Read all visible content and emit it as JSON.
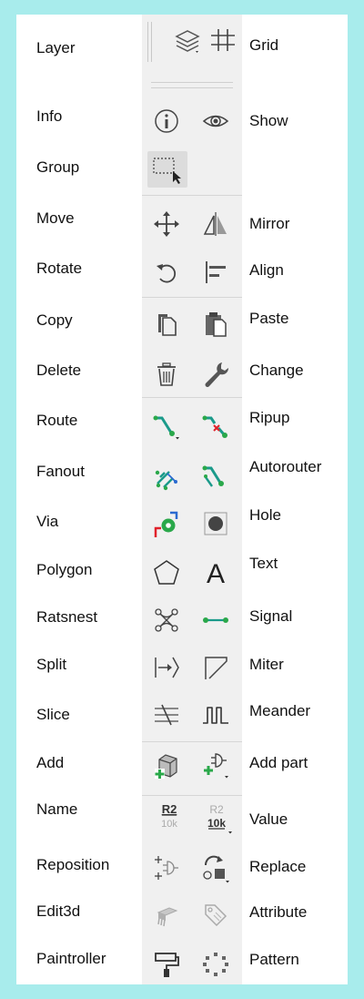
{
  "left_labels": [
    "Layer",
    "Info",
    "Group",
    "Move",
    "Rotate",
    "Copy",
    "Delete",
    "Route",
    "Fanout",
    "Via",
    "Polygon",
    "Ratsnest",
    "Split",
    "Slice",
    "Add",
    "Name",
    "Reposition",
    "Edit3d",
    "Paintroller"
  ],
  "right_labels": [
    "Grid",
    "Show",
    "Mirror",
    "Align",
    "Paste",
    "Change",
    "Ripup",
    "Autorouter",
    "Hole",
    "Text",
    "Signal",
    "Miter",
    "Meander",
    "Add part",
    "Value",
    "Replace",
    "Attribute",
    "Pattern"
  ],
  "icons": {
    "name_icon_text": "R2",
    "name_icon_subtext": "10k",
    "value_icon_text": "R2",
    "value_icon_subtext": "10k",
    "text_icon_glyph": "A"
  },
  "colors": {
    "background": "#a8ecec",
    "panel": "#ffffff",
    "toolbar": "#f0f0f0",
    "route_teal": "#1a9a8a",
    "green": "#2aa84a",
    "red": "#e0202a",
    "blue": "#2a6ad0",
    "icon_gray": "#555555"
  }
}
